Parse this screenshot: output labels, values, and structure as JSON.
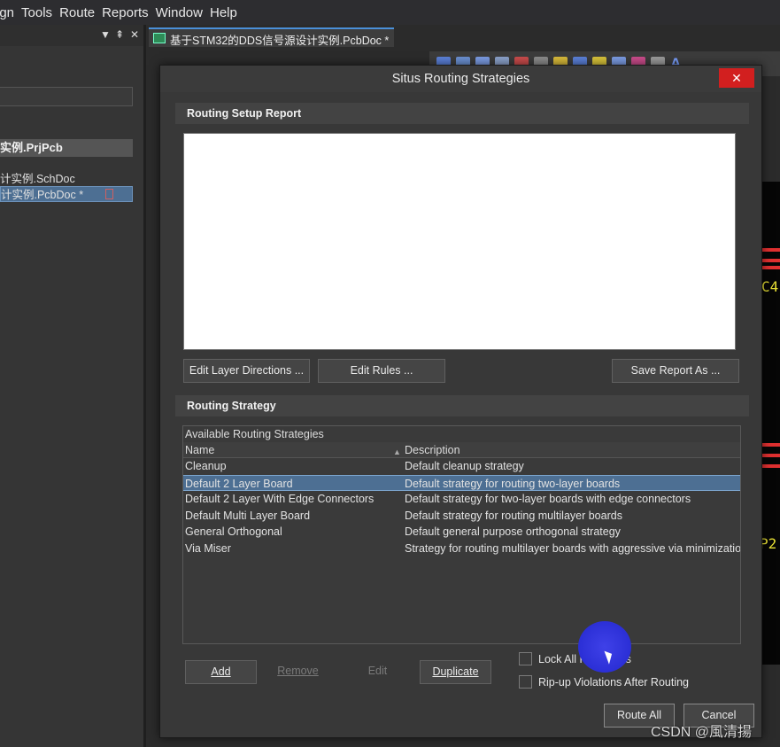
{
  "menubar": {
    "items": [
      "ign",
      "Tools",
      "Route",
      "Reports",
      "Window",
      "Help"
    ]
  },
  "left_panel": {
    "controls": [
      "▼",
      "⇞",
      "✕"
    ],
    "project": "实例.PrjPcb",
    "files": [
      {
        "label": "计实例.SchDoc",
        "selected": false
      },
      {
        "label": "计实例.PcbDoc *",
        "selected": true
      }
    ]
  },
  "doc_tab": {
    "label": "基于STM32的DDS信号源设计实例.PcbDoc *"
  },
  "pcb_canvas": {
    "labels": [
      "C4",
      "P2"
    ]
  },
  "dialog": {
    "title": "Situs Routing Strategies",
    "close_label": "✕",
    "setup_report": {
      "header": "Routing Setup Report",
      "buttons": {
        "edit_layer_directions": "Edit Layer Directions ...",
        "edit_rules": "Edit Rules ...",
        "save_report": "Save Report As ..."
      }
    },
    "strategy": {
      "header": "Routing Strategy",
      "caption": "Available Routing Strategies",
      "columns": {
        "name": "Name",
        "description": "Description"
      },
      "rows": [
        {
          "name": "Cleanup",
          "description": "Default cleanup strategy",
          "selected": false
        },
        {
          "name": "Default 2 Layer Board",
          "description": "Default strategy for routing two-layer boards",
          "selected": true
        },
        {
          "name": "Default 2 Layer With Edge Connectors",
          "description": "Default strategy for two-layer boards with edge connectors",
          "selected": false
        },
        {
          "name": "Default Multi Layer Board",
          "description": "Default strategy for routing multilayer boards",
          "selected": false
        },
        {
          "name": "General Orthogonal",
          "description": "Default general purpose orthogonal strategy",
          "selected": false
        },
        {
          "name": "Via Miser",
          "description": "Strategy for routing multilayer boards with aggressive via minimization",
          "selected": false
        }
      ],
      "buttons": {
        "add": "Add",
        "remove": "Remove",
        "edit": "Edit",
        "duplicate": "Duplicate"
      }
    },
    "options": {
      "lock_prerouted": {
        "label": "Lock All Pre-routes",
        "checked": false
      },
      "ripup_violations": {
        "label": "Rip-up Violations After Routing",
        "checked": false
      }
    },
    "footer": {
      "route_all": "Route All",
      "cancel": "Cancel"
    }
  },
  "watermark": "CSDN @風清揚"
}
